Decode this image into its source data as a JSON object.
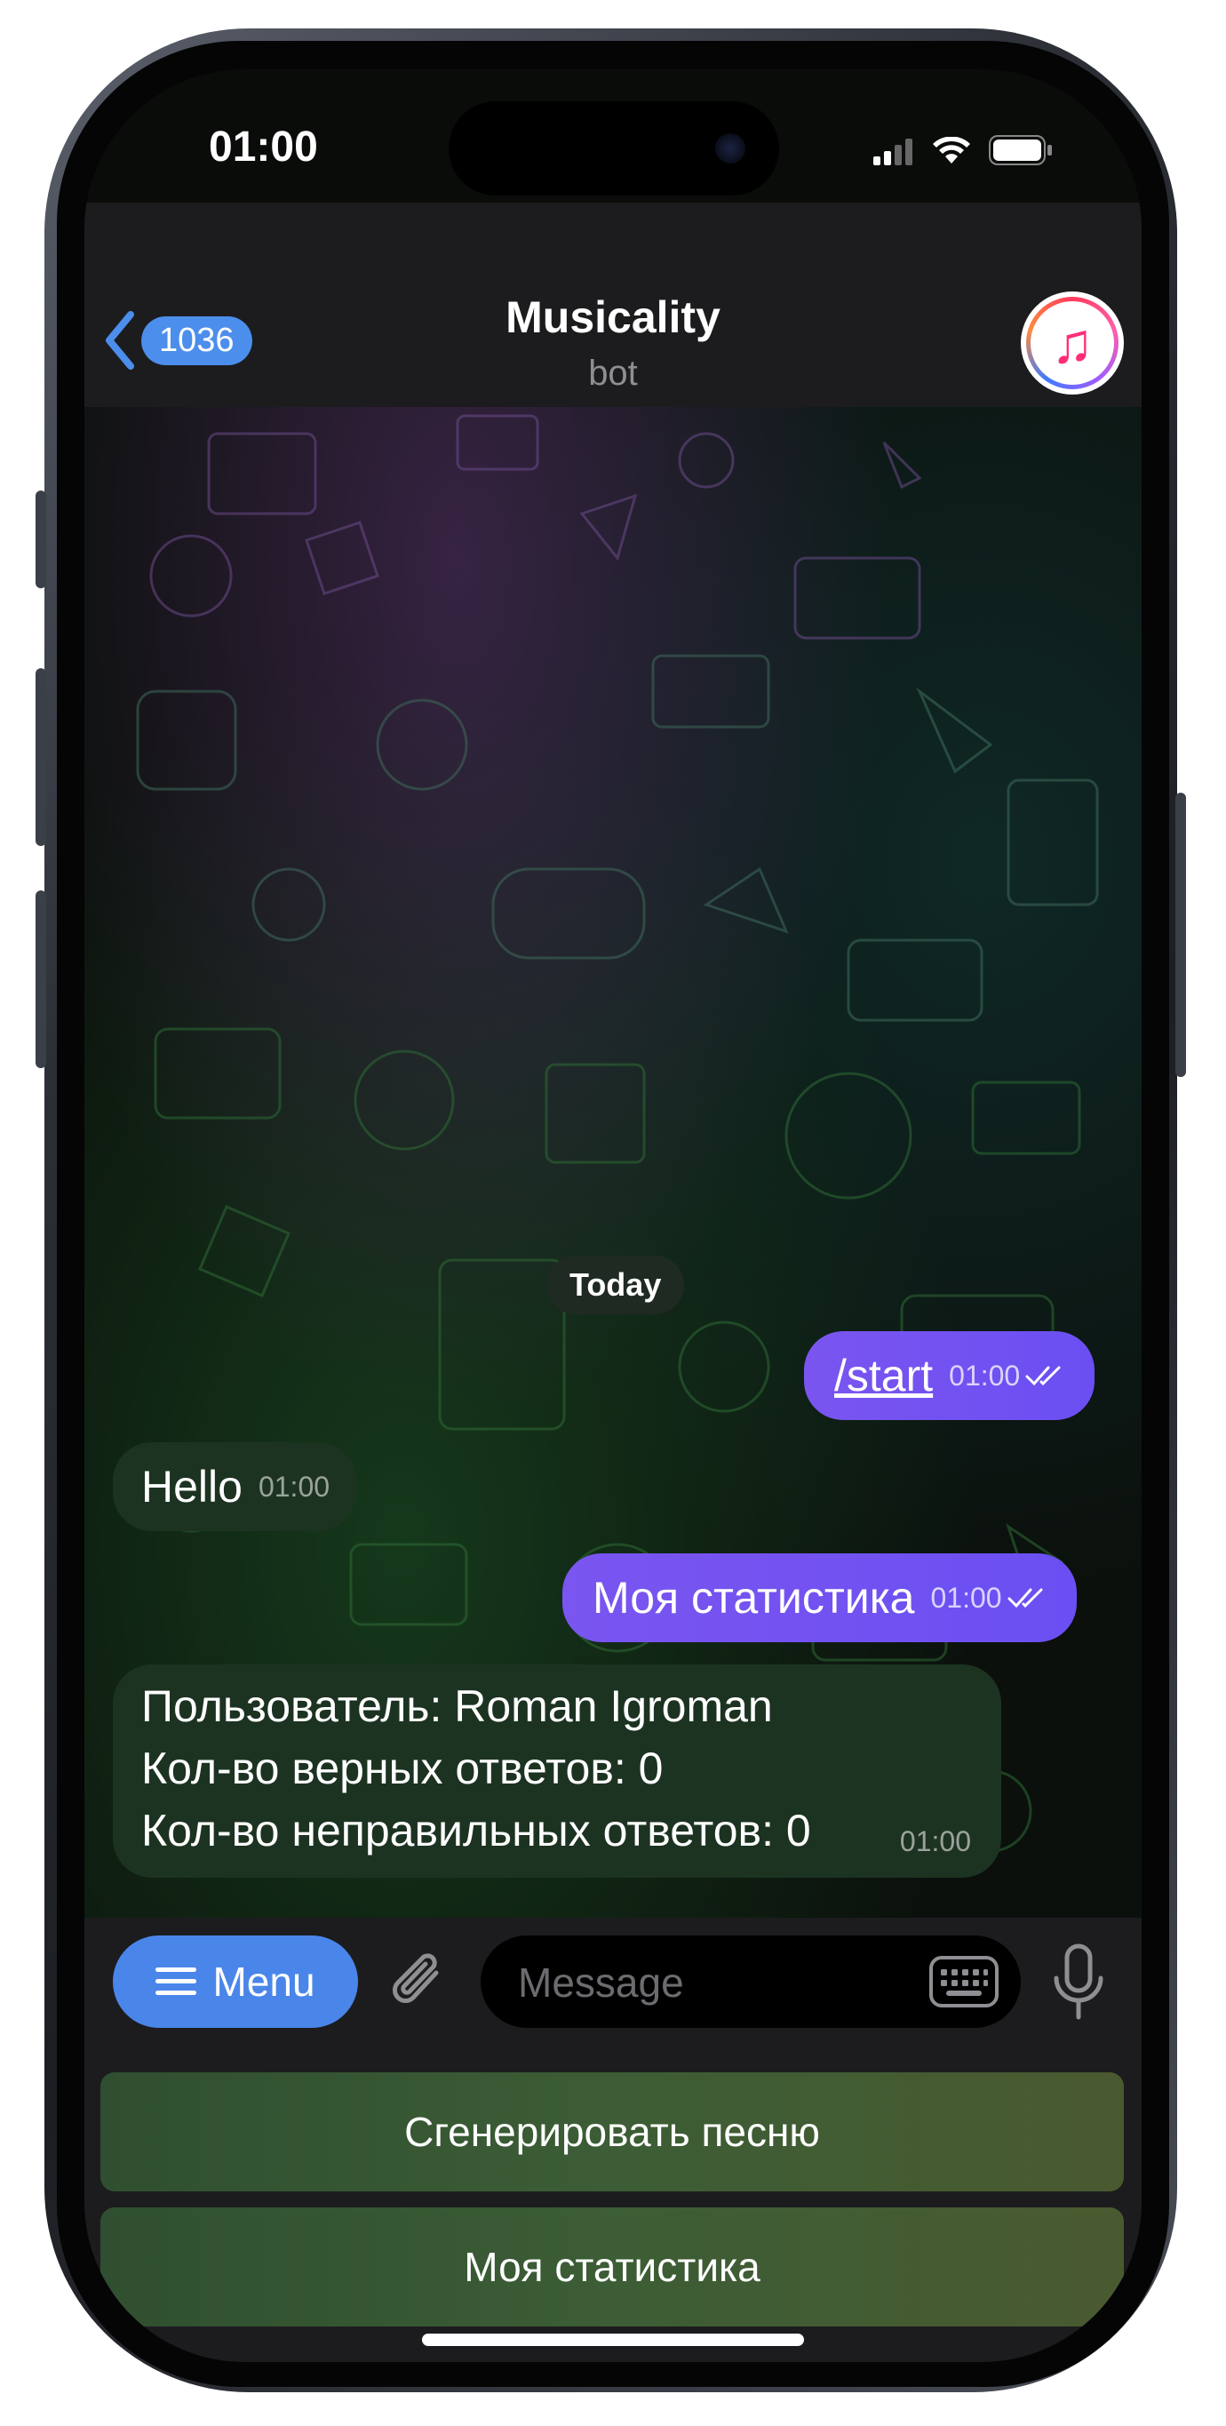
{
  "status_bar": {
    "time": "01:00"
  },
  "header": {
    "back_count": "1036",
    "title": "Musicality",
    "subtitle": "bot",
    "avatar_icon": "music-note-icon"
  },
  "chat": {
    "date_separator": "Today",
    "messages": [
      {
        "direction": "outgoing",
        "text": "/start",
        "time": "01:00",
        "status": "read"
      },
      {
        "direction": "incoming",
        "text": "Hello",
        "time": "01:00"
      },
      {
        "direction": "outgoing",
        "text": "Моя статистика",
        "time": "01:00",
        "status": "read"
      },
      {
        "direction": "incoming",
        "lines": [
          "Пользователь: Roman  Igroman",
          "Кол-во верных ответов: 0",
          "Кол-во неправильных ответов: 0"
        ],
        "time": "01:00"
      }
    ]
  },
  "input_bar": {
    "menu_label": "Menu",
    "placeholder": "Message"
  },
  "reply_keyboard": {
    "buttons": [
      "Сгенерировать песню",
      "Моя статистика"
    ]
  },
  "colors": {
    "outgoing_bubble": "#7052f0",
    "incoming_bubble": "#1d3322",
    "accent": "#4a86ea",
    "keyboard_button": "#3c5d35"
  }
}
